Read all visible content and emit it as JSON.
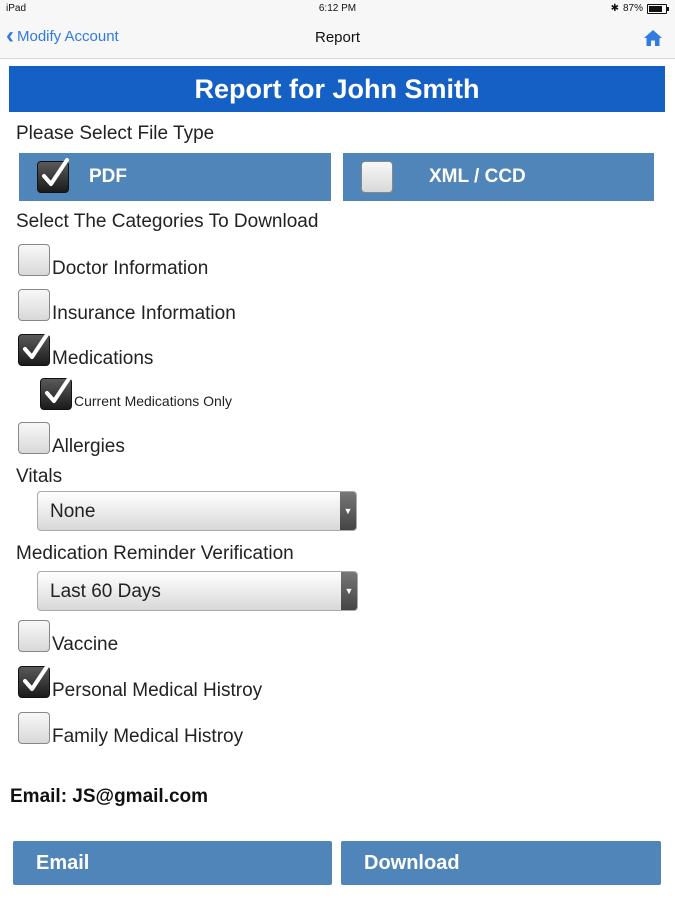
{
  "status": {
    "device": "iPad",
    "time": "6:12 PM",
    "battery": "87%",
    "battery_level": 0.87
  },
  "nav": {
    "back_label": "Modify Account",
    "title": "Report"
  },
  "header": {
    "title": "Report for John Smith"
  },
  "file_type": {
    "label": "Please Select File Type",
    "options": [
      {
        "label": "PDF",
        "checked": true
      },
      {
        "label": "XML / CCD",
        "checked": false
      }
    ]
  },
  "categories": {
    "label": "Select The Categories To Download",
    "doctor": {
      "label": "Doctor Information",
      "checked": false
    },
    "insurance": {
      "label": "Insurance Information",
      "checked": false
    },
    "medications": {
      "label": "Medications",
      "checked": true
    },
    "current_meds": {
      "label": "Current Medications Only",
      "checked": true
    },
    "allergies": {
      "label": "Allergies",
      "checked": false
    },
    "vitals": {
      "label": "Vitals",
      "value": "None"
    },
    "reminder": {
      "label": "Medication Reminder Verification",
      "value": "Last 60 Days"
    },
    "vaccine": {
      "label": "Vaccine",
      "checked": false
    },
    "personal_history": {
      "label": "Personal Medical Histroy",
      "checked": true
    },
    "family_history": {
      "label": "Family Medical Histroy",
      "checked": false
    }
  },
  "email": {
    "text": "Email: JS@gmail.com"
  },
  "buttons": {
    "email": "Email",
    "download": "Download"
  },
  "colors": {
    "header": "#1560c4",
    "button": "#4f85b8",
    "link": "#2f7be0"
  }
}
